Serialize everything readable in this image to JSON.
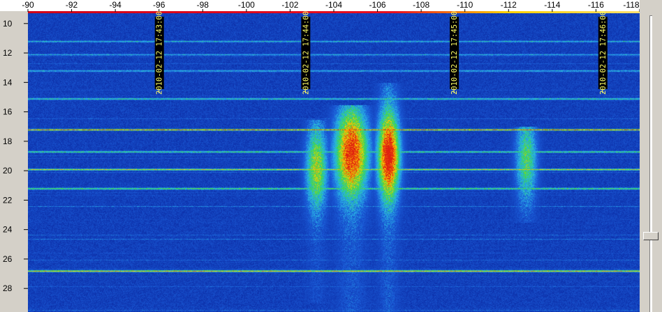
{
  "chart_data": {
    "type": "heatmap",
    "title": "",
    "xlabel": "",
    "ylabel": "",
    "x_ticks": [
      "-90",
      "-92",
      "-94",
      "-96",
      "-98",
      "-100",
      "-102",
      "-104",
      "-106",
      "-108",
      "-110",
      "-112",
      "-114",
      "-116",
      "-118"
    ],
    "y_ticks": [
      "10",
      "12",
      "14",
      "16",
      "18",
      "20",
      "22",
      "24",
      "26",
      "28"
    ],
    "xlim": [
      -90,
      -118
    ],
    "ylim": [
      9.3,
      29.6
    ],
    "timestamps": [
      {
        "text": "2010-02-12 17:43:00",
        "x": -96.0
      },
      {
        "text": "2010-02-12 17:44:00",
        "x": -102.7
      },
      {
        "text": "2010-02-12 17:45:00",
        "x": -109.5
      },
      {
        "text": "2010-02-12 17:46:00",
        "x": -116.3
      }
    ],
    "hot_bands": [
      {
        "x": -104.8,
        "width": 0.9,
        "y_from": 15.5,
        "y_to": 29.6,
        "peak_y": 18.8,
        "intensity": 0.95
      },
      {
        "x": -103.2,
        "width": 0.6,
        "y_from": 16.5,
        "y_to": 29.0,
        "peak_y": 19.8,
        "intensity": 0.7
      },
      {
        "x": -106.5,
        "width": 0.6,
        "y_from": 14.0,
        "y_to": 29.6,
        "peak_y": 19.0,
        "intensity": 1.0
      },
      {
        "x": -112.8,
        "width": 0.6,
        "y_from": 17.0,
        "y_to": 23.5,
        "peak_y": 19.2,
        "intensity": 0.6
      }
    ],
    "horizontal_lines": [
      {
        "y": 11.2,
        "intensity": 0.55
      },
      {
        "y": 12.1,
        "intensity": 0.5
      },
      {
        "y": 13.2,
        "intensity": 0.55
      },
      {
        "y": 15.1,
        "intensity": 0.65
      },
      {
        "y": 17.2,
        "intensity": 0.95
      },
      {
        "y": 18.7,
        "intensity": 0.7
      },
      {
        "y": 19.9,
        "intensity": 0.8
      },
      {
        "y": 21.2,
        "intensity": 0.75
      },
      {
        "y": 26.8,
        "intensity": 0.9
      }
    ],
    "colors": {
      "background": "#0c2ea8",
      "low": "#1b5cd8",
      "mid": "#29b6e6",
      "high": "#38d84a",
      "peak": "#ffd000",
      "max": "#e02010"
    }
  },
  "scrollbar": {
    "position": 0.75
  }
}
